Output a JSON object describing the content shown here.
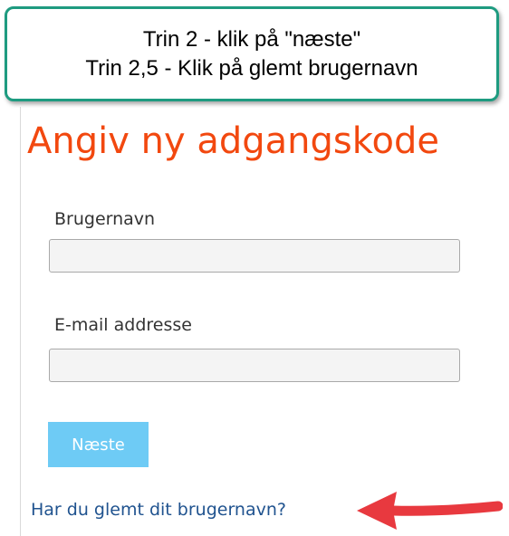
{
  "callout": {
    "line1": "Trin 2 - klik på \"næste\"",
    "line2": "Trin 2,5 - Klik på glemt brugernavn",
    "border_color": "#1e9b80"
  },
  "form": {
    "title": "Angiv ny adgangskode",
    "title_color": "#f2480f",
    "username_label": "Brugernavn",
    "username_value": "",
    "email_label": "E-mail addresse",
    "email_value": "",
    "next_button_label": "Næste",
    "next_button_color": "#6ecbf5",
    "forgot_username_link": "Har du glemt dit brugernavn?",
    "link_color": "#20538f"
  },
  "annotation": {
    "arrow_icon": "red-arrow-left-icon",
    "arrow_color": "#e8393f"
  }
}
